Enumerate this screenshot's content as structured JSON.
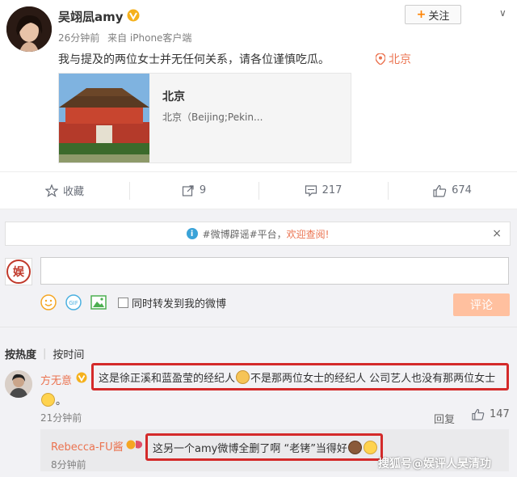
{
  "post": {
    "username": "吴翊凨amy",
    "follow_label": "关注",
    "more_label": "∨",
    "time": "26分钟前",
    "source": "来自 iPhone客户端",
    "text": "我与提及的两位女士并无任何关系，请各位谨慎吃瓜。",
    "location": "北京",
    "card": {
      "title": "北京",
      "desc": "北京（Beijing;Pekin..."
    }
  },
  "actions": {
    "favorite": "收藏",
    "repost": "9",
    "comment": "217",
    "like": "674"
  },
  "rumor_bar": {
    "prefix": "#微博辟谣#平台，",
    "link": "欢迎查阅!",
    "close": "×"
  },
  "composer": {
    "my_avatar_text": "娱",
    "checkbox_label": "同时转发到我的微博",
    "submit_label": "评论"
  },
  "sort": {
    "hot": "按热度",
    "time": "按时间"
  },
  "comment1": {
    "author": "方无意",
    "text_a": "这是徐正溪和蓝盈莹的经纪人",
    "text_b": "不是那两位女士的经纪人 公司艺人也没有那两位女士",
    "tail": "。",
    "time": "21分钟前",
    "reply_label": "回复",
    "likes": "147"
  },
  "reply1": {
    "author": "Rebecca-FU酱",
    "text": "这另一个amy微博全删了啊 “老铐”当得好",
    "time": "8分钟前"
  },
  "watermark": "搜狐号@娱评人昊清功",
  "colors": {
    "orange_link": "#eb7350",
    "highlight_border": "#d42a2a",
    "submit_disabled": "#ffc09f"
  }
}
